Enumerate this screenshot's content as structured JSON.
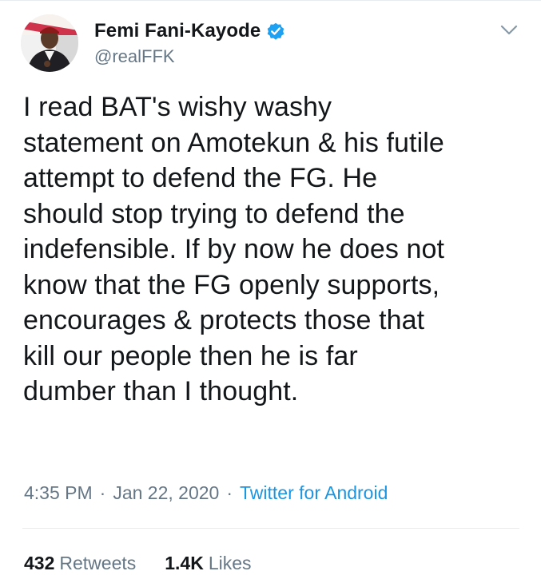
{
  "tweet": {
    "author": {
      "display_name": "Femi Fani-Kayode",
      "handle": "@realFFK",
      "verified": true
    },
    "text": "I read BAT's wishy washy\nstatement on Amotekun & his futile\nattempt to defend the FG. He\nshould stop trying to defend the\nindefensible. If by now he does not\nknow that the FG openly supports,\nencourages & protects those that\nkill our people then he is far\ndumber than I thought.",
    "time": "4:35 PM",
    "date": "Jan 22, 2020",
    "separator": "·",
    "source": "Twitter for Android",
    "retweets": {
      "count": "432",
      "label": "Retweets"
    },
    "likes": {
      "count": "1.4K",
      "label": "Likes"
    }
  },
  "colors": {
    "accent": "#1b95e0",
    "verified_badge": "#1da1f2",
    "secondary_text": "#657786",
    "primary_text": "#14171a"
  },
  "icons": {
    "verified": "verified-badge-icon",
    "menu": "chevron-down-icon"
  }
}
